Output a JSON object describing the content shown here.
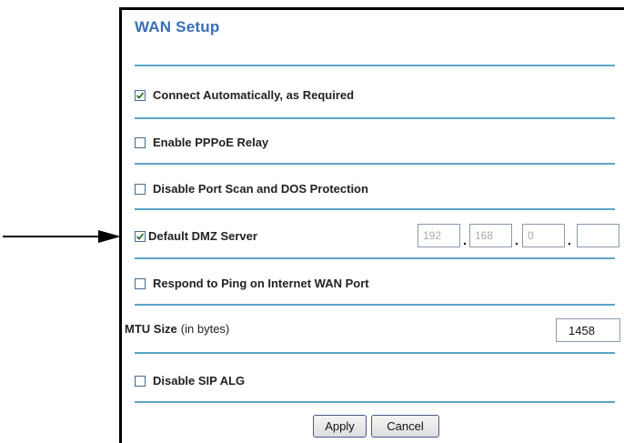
{
  "title": "WAN Setup",
  "options": {
    "connect_auto": {
      "label": "Connect Automatically, as Required",
      "checked": true
    },
    "pppoe_relay": {
      "label": "Enable PPPoE Relay",
      "checked": false
    },
    "disable_port_scan": {
      "label": "Disable Port Scan and DOS Protection",
      "checked": false
    },
    "dmz": {
      "label": "Default DMZ Server",
      "checked": true,
      "ip": [
        "192",
        "168",
        "0",
        ""
      ]
    },
    "respond_ping": {
      "label": "Respond to Ping on Internet WAN Port",
      "checked": false
    },
    "disable_sip": {
      "label": "Disable SIP ALG",
      "checked": false
    }
  },
  "mtu": {
    "label": "MTU Size",
    "unit": "(in bytes)",
    "value": "1458"
  },
  "buttons": {
    "apply": "Apply",
    "cancel": "Cancel"
  },
  "ip_separator": ".",
  "colors": {
    "title": "#3a6fb4",
    "divider": "#5ba4c8"
  }
}
